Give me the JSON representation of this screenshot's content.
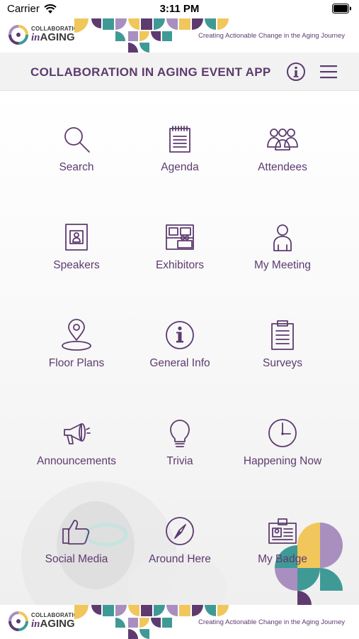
{
  "status_bar": {
    "carrier": "Carrier",
    "time": "3:11 PM"
  },
  "banner": {
    "logo_line1": "COLLABORATION",
    "logo_line2_prefix": "in",
    "logo_line2": "AGING",
    "tagline": "Creating Actionable Change in the Aging Journey"
  },
  "header": {
    "title": "COLLABORATION IN AGING EVENT APP"
  },
  "colors": {
    "accent": "#5d3b6f",
    "teal": "#3f9a96",
    "gold": "#f1c75b",
    "lavender": "#a98fc0"
  },
  "tiles": [
    {
      "label": "Search",
      "icon": "search-icon"
    },
    {
      "label": "Agenda",
      "icon": "notepad-icon"
    },
    {
      "label": "Attendees",
      "icon": "people-group-icon"
    },
    {
      "label": "Speakers",
      "icon": "id-card-icon"
    },
    {
      "label": "Exhibitors",
      "icon": "booth-icon"
    },
    {
      "label": "My Meeting",
      "icon": "person-icon"
    },
    {
      "label": "Floor Plans",
      "icon": "map-pin-icon"
    },
    {
      "label": "General Info",
      "icon": "info-circle-icon"
    },
    {
      "label": "Surveys",
      "icon": "clipboard-icon"
    },
    {
      "label": "Announcements",
      "icon": "megaphone-icon"
    },
    {
      "label": "Trivia",
      "icon": "lightbulb-icon"
    },
    {
      "label": "Happening Now",
      "icon": "clock-icon"
    },
    {
      "label": "Social Media",
      "icon": "thumbs-up-icon"
    },
    {
      "label": "Around Here",
      "icon": "compass-icon"
    },
    {
      "label": "My Badge",
      "icon": "badge-icon"
    }
  ]
}
